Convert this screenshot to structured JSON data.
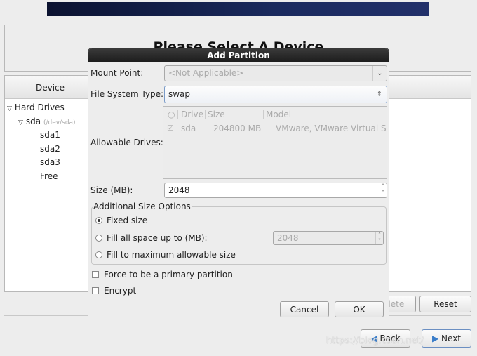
{
  "page": {
    "title": "Please Select A Device"
  },
  "device_panel": {
    "header": "Device",
    "tree": [
      {
        "label": "Hard Drives"
      },
      {
        "label": "sda",
        "sub": "(/dev/sda)"
      },
      {
        "label": "sda1"
      },
      {
        "label": "sda2"
      },
      {
        "label": "sda3"
      },
      {
        "label": "Free"
      }
    ]
  },
  "bg_buttons": {
    "delete": "Delete",
    "reset": "Reset",
    "back": "Back",
    "next": "Next"
  },
  "dialog": {
    "title": "Add Partition",
    "mount_point": {
      "label": "Mount Point:",
      "value": "<Not Applicable>"
    },
    "fs_type": {
      "label": "File System Type:",
      "value": "swap"
    },
    "drives": {
      "label": "Allowable Drives:",
      "columns": [
        "Drive",
        "Size",
        "Model"
      ],
      "rows": [
        {
          "checked": true,
          "drive": "sda",
          "size": "204800 MB",
          "model": "VMware, VMware Virtual S"
        }
      ]
    },
    "size": {
      "label": "Size (MB):",
      "value": "2048"
    },
    "size_options": {
      "legend": "Additional Size Options",
      "fixed": "Fixed size",
      "fill_upto": "Fill all space up to (MB):",
      "fill_upto_value": "2048",
      "fill_max": "Fill to maximum allowable size",
      "selected": "fixed"
    },
    "primary": {
      "label": "Force to be a primary partition",
      "checked": false
    },
    "encrypt": {
      "label": "Encrypt",
      "checked": false
    },
    "cancel": "Cancel",
    "ok": "OK"
  },
  "watermark": "https://blog.csdn.net/"
}
